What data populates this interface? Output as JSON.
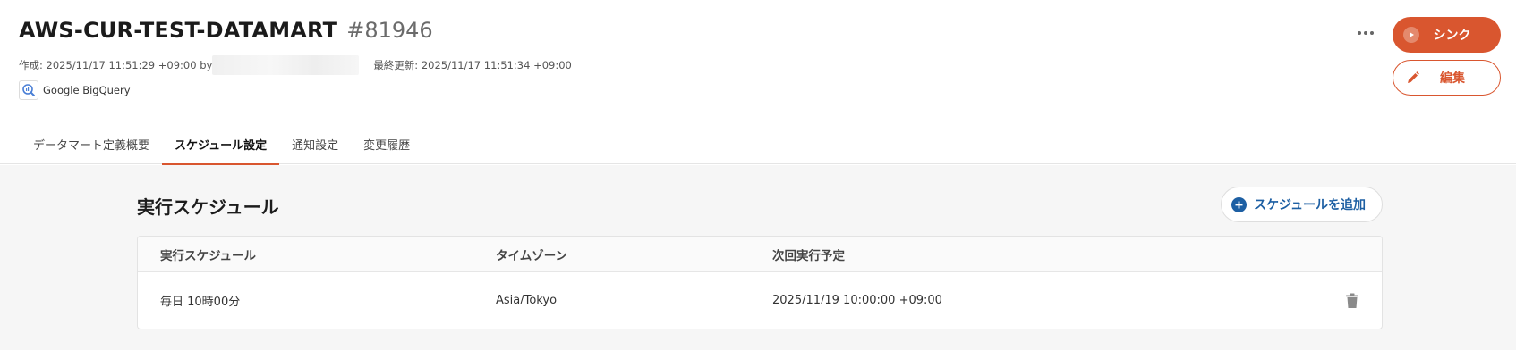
{
  "header": {
    "title": "AWS-CUR-TEST-DATAMART",
    "id": "#81946",
    "created": "作成: 2025/11/17 11:51:29 +09:00 by",
    "updated": "最終更新: 2025/11/17 11:51:34 +09:00",
    "source_label": "Google BigQuery",
    "source_icon": "bigquery-icon"
  },
  "actions": {
    "more_icon": "more-horizontal-icon",
    "sync_label": "シンク",
    "sync_icon": "play-circle-icon",
    "edit_label": "編集",
    "edit_icon": "pencil-icon"
  },
  "tabs": [
    {
      "label": "データマート定義概要",
      "active": false
    },
    {
      "label": "スケジュール設定",
      "active": true
    },
    {
      "label": "通知設定",
      "active": false
    },
    {
      "label": "変更履歴",
      "active": false
    }
  ],
  "schedule": {
    "title": "実行スケジュール",
    "add_label": "スケジュールを追加",
    "add_icon": "plus-circle-icon",
    "columns": [
      "実行スケジュール",
      "タイムゾーン",
      "次回実行予定"
    ],
    "rows": [
      {
        "schedule": "毎日 10時00分",
        "timezone": "Asia/Tokyo",
        "next_run": "2025/11/19 10:00:00 +09:00",
        "action_icon": "trash-icon"
      }
    ]
  },
  "colors": {
    "accent": "#d9562f",
    "link": "#1d5fa3",
    "body_bg": "#f6f6f6"
  }
}
